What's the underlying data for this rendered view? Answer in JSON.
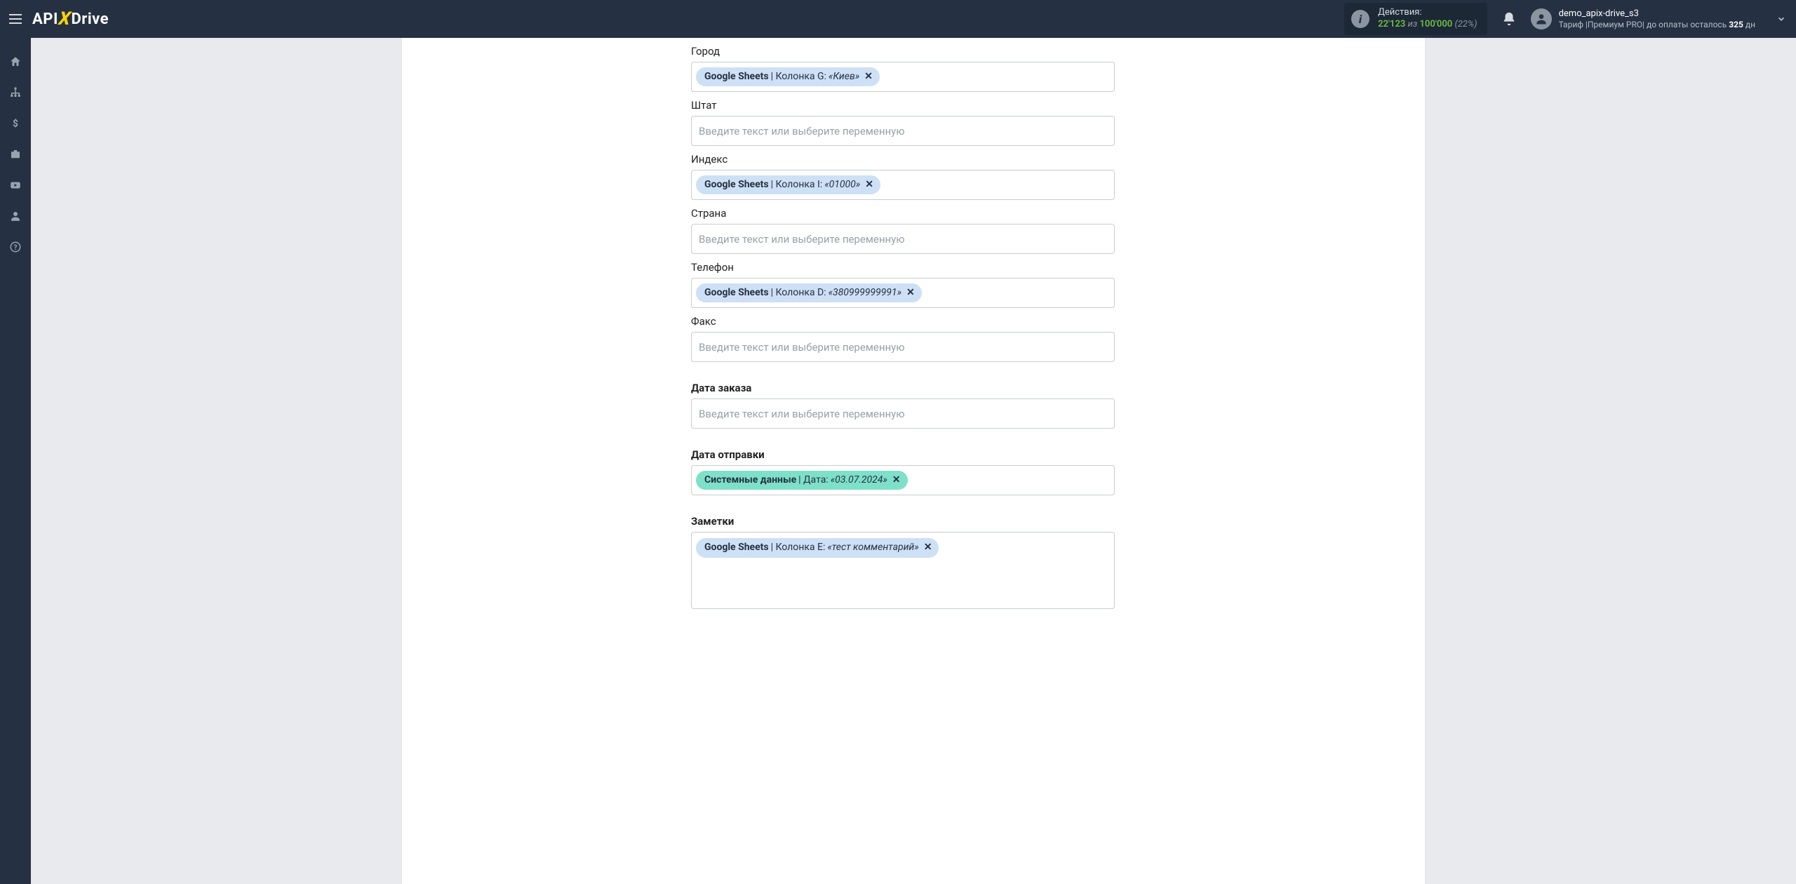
{
  "header": {
    "actions_label": "Действия:",
    "actions_current": "22'123",
    "actions_sep": "из",
    "actions_total": "100'000",
    "actions_pct": "(22%)",
    "username": "demo_apix-drive_s3",
    "tariff_prefix": "Тариф |",
    "tariff_name": "Премиум PRO",
    "tariff_sep": "|  до оплаты осталось ",
    "days": "325",
    "days_suffix": " дн"
  },
  "logo": {
    "part1": "API",
    "x": "X",
    "part2": "Drive"
  },
  "placeholders": {
    "generic": "Введите текст или выберите переменную"
  },
  "fields": {
    "city": {
      "label": "Город",
      "pill": {
        "type": "blue",
        "source": "Google Sheets",
        "col": " | Колонка G: ",
        "val": "«Киев»"
      }
    },
    "state": {
      "label": "Штат"
    },
    "index": {
      "label": "Индекс",
      "pill": {
        "type": "blue",
        "source": "Google Sheets",
        "col": " | Колонка I: ",
        "val": "«01000»"
      }
    },
    "country": {
      "label": "Страна"
    },
    "phone": {
      "label": "Телефон",
      "pill": {
        "type": "blue",
        "source": "Google Sheets",
        "col": " | Колонка D: ",
        "val": "«380999999991»"
      }
    },
    "fax": {
      "label": "Факс"
    },
    "order_date": {
      "label": "Дата заказа"
    },
    "ship_date": {
      "label": "Дата отправки",
      "pill": {
        "type": "teal",
        "source": "Системные данные",
        "col": " | Дата: ",
        "val": "«03.07.2024»"
      }
    },
    "notes": {
      "label": "Заметки",
      "pill": {
        "type": "blue",
        "source": "Google Sheets",
        "col": " | Колонка E: ",
        "val": "«тест комментарий»"
      }
    }
  }
}
